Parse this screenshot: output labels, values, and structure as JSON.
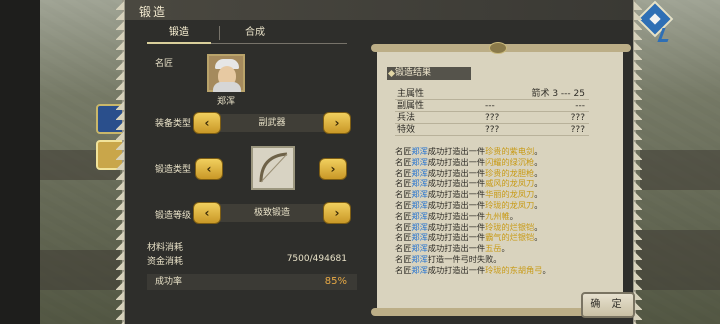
{
  "window": {
    "title": "锻造"
  },
  "tabs": [
    {
      "label": "锻造",
      "active": true
    },
    {
      "label": "合成",
      "active": false
    }
  ],
  "form": {
    "master_label": "名匠",
    "master_name": "郑浑",
    "equip_type_label": "装备类型",
    "equip_type_value": "副武器",
    "forge_type_label": "锻造类型",
    "forge_level_label": "锻造等级",
    "forge_level_value": "极致锻造",
    "material_label": "材料消耗",
    "material_value": "",
    "funds_label": "资金消耗",
    "funds_value": "7500/494681",
    "success_label": "成功率",
    "success_value": "85%"
  },
  "result": {
    "title": "锻造结果",
    "rows": [
      {
        "c0": "主属性",
        "c1": "",
        "c2": "箭术 3 --- 25"
      },
      {
        "c0": "副属性",
        "c1": "---",
        "c2": "---"
      },
      {
        "c0": "兵法",
        "c1": "???",
        "c2": "???"
      },
      {
        "c0": "特效",
        "c1": "???",
        "c2": "???"
      }
    ],
    "log": [
      {
        "pre": "名匠",
        "who": "郑浑",
        "mid": "成功打造出一件",
        "item": "珍贵的紫电剑",
        "post": "。"
      },
      {
        "pre": "名匠",
        "who": "郑浑",
        "mid": "成功打造出一件",
        "item": "闪耀的绿沉枪",
        "post": "。"
      },
      {
        "pre": "名匠",
        "who": "郑浑",
        "mid": "成功打造出一件",
        "item": "珍贵的龙胆枪",
        "post": "。"
      },
      {
        "pre": "名匠",
        "who": "郑浑",
        "mid": "成功打造出一件",
        "item": "威风的龙凤刀",
        "post": "。"
      },
      {
        "pre": "名匠",
        "who": "郑浑",
        "mid": "成功打造出一件",
        "item": "华丽的龙凤刀",
        "post": "。"
      },
      {
        "pre": "名匠",
        "who": "郑浑",
        "mid": "成功打造出一件",
        "item": "玲珑的龙凤刀",
        "post": "。"
      },
      {
        "pre": "名匠",
        "who": "郑浑",
        "mid": "成功打造出一件",
        "item": "九州帷",
        "post": "。"
      },
      {
        "pre": "名匠",
        "who": "郑浑",
        "mid": "成功打造出一件",
        "item": "玲珑的烂银铠",
        "post": "。"
      },
      {
        "pre": "名匠",
        "who": "郑浑",
        "mid": "成功打造出一件",
        "item": "霸气的烂银铠",
        "post": "。"
      },
      {
        "pre": "名匠",
        "who": "郑浑",
        "mid": "成功打造出一件",
        "item": "五岳",
        "post": "。"
      },
      {
        "pre": "名匠",
        "who": "郑浑",
        "mid": "打造一件弓时失败",
        "item": "",
        "post": "。"
      },
      {
        "pre": "名匠",
        "who": "郑浑",
        "mid": "成功打造出一件",
        "item": "玲珑的东胡角弓",
        "post": "。"
      }
    ]
  },
  "buttons": {
    "confirm": "确 定",
    "prev_glyph": "‹",
    "next_glyph": "›"
  },
  "icons": {
    "corner": "gem-icon",
    "forge_type_item": "bow-icon"
  },
  "colors": {
    "panel": "#2e2e2b",
    "scroll": "#d9d3be",
    "accent_gold": "#e7a945",
    "name_blue": "#1e6fd0",
    "item_gold": "#c89a14"
  }
}
